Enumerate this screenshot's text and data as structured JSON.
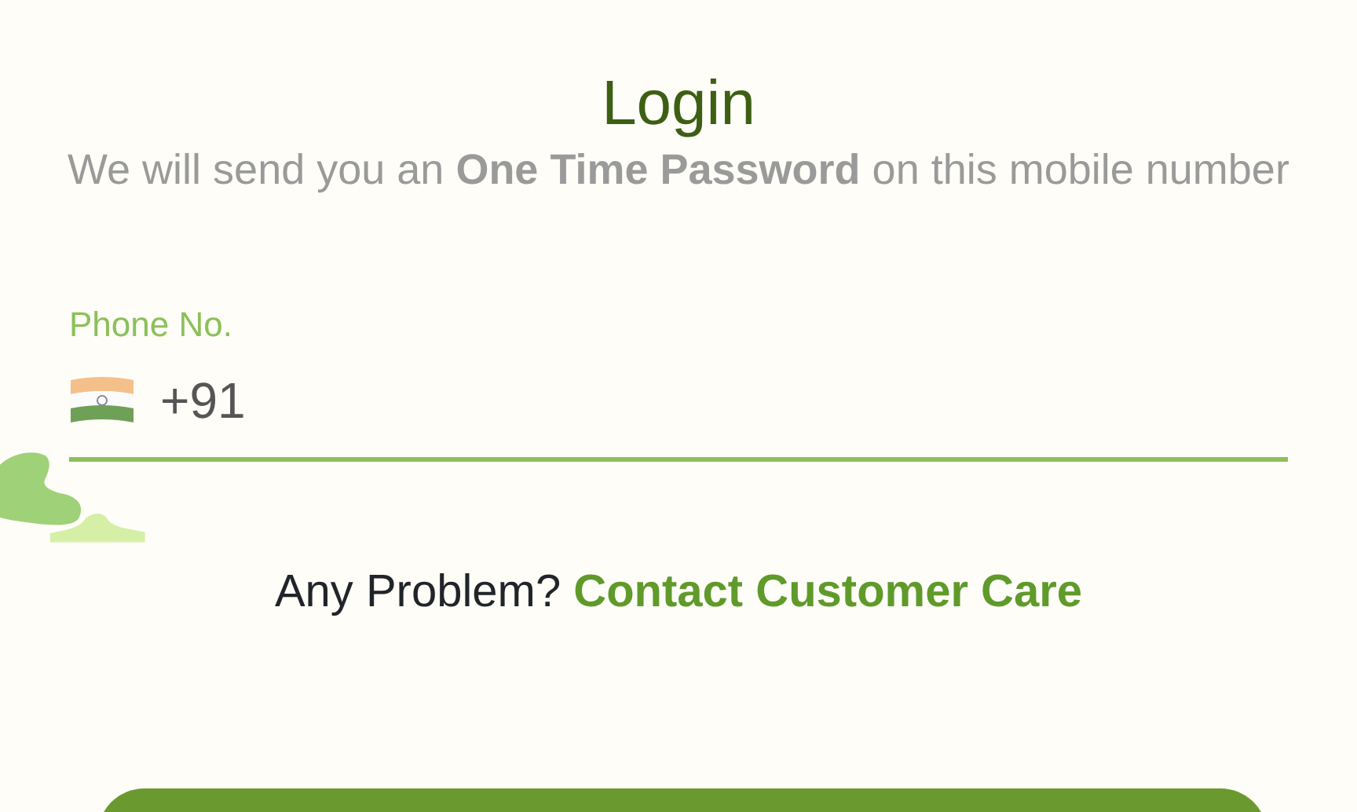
{
  "title": "Login",
  "subtitle": "We will send you an **One Time Password** on this mobile number",
  "phone_field": {
    "label": "Phone No.",
    "country_code": "+91"
  },
  "help": {
    "text": "Any Problem?",
    "link": "Contact Customer Care"
  }
}
